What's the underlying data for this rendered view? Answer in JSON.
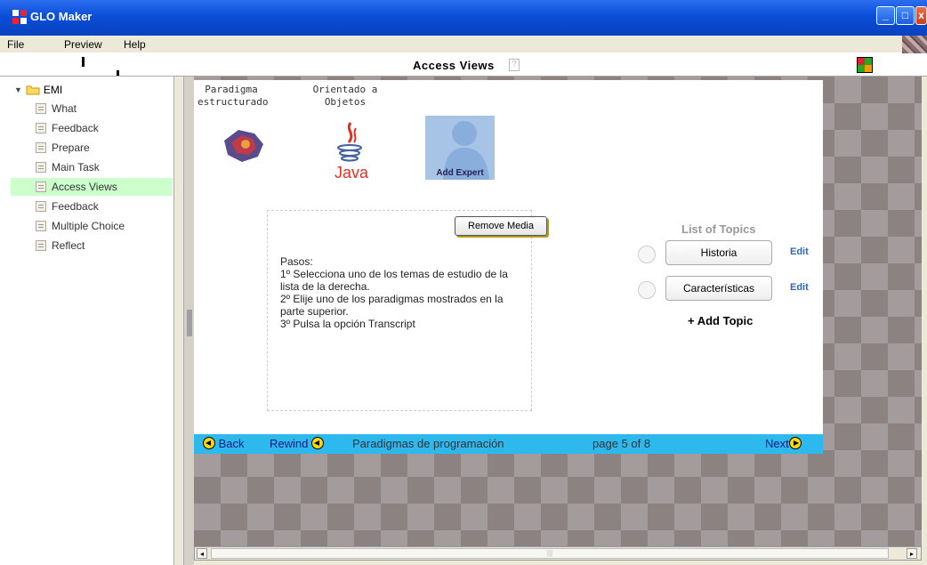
{
  "window": {
    "title": "GLO Maker"
  },
  "menu": [
    "File",
    "Preview",
    "Help"
  ],
  "view": {
    "title": "Access Views"
  },
  "sidebar": {
    "root": "EMI",
    "items": [
      {
        "label": "What"
      },
      {
        "label": "Feedback"
      },
      {
        "label": "Prepare"
      },
      {
        "label": "Main Task"
      },
      {
        "label": "Access Views"
      },
      {
        "label": "Feedback"
      },
      {
        "label": "Multiple Choice"
      },
      {
        "label": "Reflect"
      }
    ]
  },
  "perspectives": [
    {
      "label": "Paradigma\nestructurado"
    },
    {
      "label": "Orientado a\nObjetos"
    }
  ],
  "expert": {
    "label": "Add Expert"
  },
  "java": {
    "label": "Java"
  },
  "media": {
    "remove_label": "Remove Media",
    "steps": "Pasos:\n1º Selecciona uno de los temas de estudio de la lista de la derecha.\n2º Elije uno de los paradigmas mostrados en la parte superior.\n3º Pulsa la opción Transcript"
  },
  "topics": {
    "title": "List of Topics",
    "items": [
      {
        "label": "Historia",
        "edit": "Edit"
      },
      {
        "label": "Características",
        "edit": "Edit"
      }
    ],
    "add": "+ Add Topic"
  },
  "nav": {
    "back": "Back",
    "rewind": "Rewind",
    "title": "Paradigmas de programación",
    "page": "page 5 of 8",
    "next": "Next"
  },
  "colors": {
    "navbar": "#2db8ee",
    "selected_item": "#ccffcc",
    "titlebar": "#0a4ed8"
  }
}
